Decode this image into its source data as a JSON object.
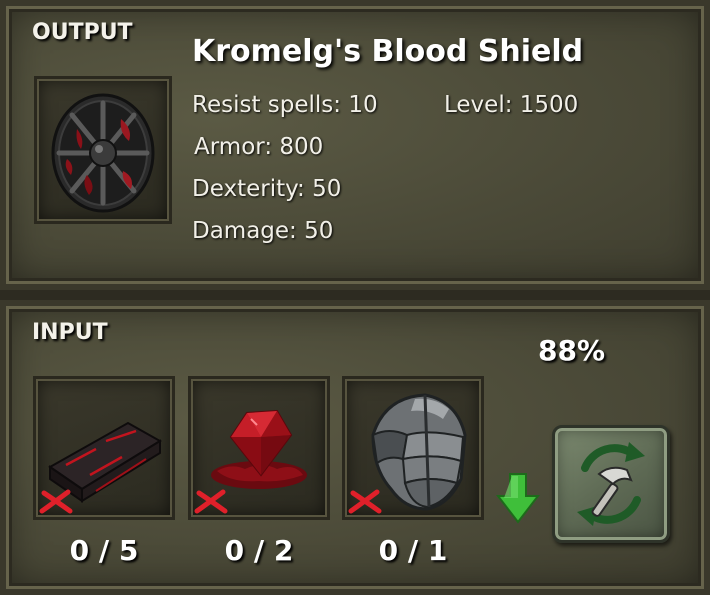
{
  "output": {
    "section_label": "OUTPUT",
    "item_name": "Kromelg's Blood Shield",
    "item_icon": "blood-shield-icon",
    "stats": {
      "resist_spells": "Resist spells: 10",
      "level": "Level: 1500",
      "armor": "Armor: 800",
      "dexterity": "Dexterity: 50",
      "damage": "Damage: 50"
    }
  },
  "input": {
    "section_label": "INPUT",
    "success_chance": "88%",
    "ingredients": [
      {
        "icon": "blood-bar-icon",
        "count": "0 / 5"
      },
      {
        "icon": "blood-gem-icon",
        "count": "0 / 2"
      },
      {
        "icon": "iron-helmet-icon",
        "count": "0 / 1"
      }
    ],
    "arrow_icon": "green-down-arrow-icon",
    "craft_button_icon": "hammer-craft-icon"
  },
  "colors": {
    "panel": "#4b4a38",
    "missing_mark": "#e0202a",
    "arrow": "#3fbf3a",
    "craft_button": "#6b7a5f"
  }
}
